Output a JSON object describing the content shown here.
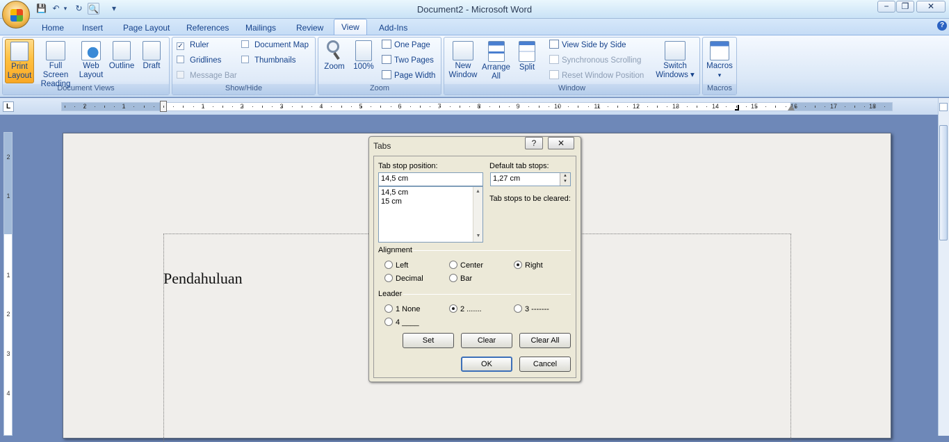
{
  "window": {
    "title": "Document2 - Microsoft Word",
    "minimize": "−",
    "restore": "❐",
    "close": "✕"
  },
  "qat": {
    "save": "💾",
    "undo": "↶",
    "undo_dd": "▾",
    "redo": "↻",
    "print_preview": "🔍",
    "customize": "▾"
  },
  "tabs": [
    "Home",
    "Insert",
    "Page Layout",
    "References",
    "Mailings",
    "Review",
    "View",
    "Add-Ins"
  ],
  "active_tab": "View",
  "help": "?",
  "ribbon": {
    "document_views": {
      "label": "Document Views",
      "buttons": [
        "Print Layout",
        "Full Screen Reading",
        "Web Layout",
        "Outline",
        "Draft"
      ],
      "print_l1": "Print",
      "print_l2": "Layout",
      "full_l1": "Full Screen",
      "full_l2": "Reading",
      "web_l1": "Web",
      "web_l2": "Layout",
      "outline": "Outline",
      "draft": "Draft"
    },
    "show_hide": {
      "label": "Show/Hide",
      "ruler": "Ruler",
      "gridlines": "Gridlines",
      "message_bar": "Message Bar",
      "document_map": "Document Map",
      "thumbnails": "Thumbnails",
      "ruler_checked": true
    },
    "zoom": {
      "label": "Zoom",
      "zoom": "Zoom",
      "percent": "100%",
      "one_page": "One Page",
      "two_pages": "Two Pages",
      "page_width": "Page Width"
    },
    "window": {
      "label": "Window",
      "new_l1": "New",
      "new_l2": "Window",
      "arrange_l1": "Arrange",
      "arrange_l2": "All",
      "split": "Split",
      "side_by_side": "View Side by Side",
      "sync_scroll": "Synchronous Scrolling",
      "reset_pos": "Reset Window Position",
      "switch_l1": "Switch",
      "switch_l2": "Windows ▾"
    },
    "macros": {
      "label": "Macros",
      "macros": "Macros",
      "dd": "▾"
    }
  },
  "ruler": {
    "corner": "L",
    "left_numbers": [
      "2",
      "1"
    ],
    "right_numbers": [
      "1",
      "2",
      "3",
      "4",
      "5",
      "6",
      "7",
      "8",
      "9",
      "10",
      "11",
      "12",
      "13",
      "14",
      "15",
      "16",
      "17",
      "18"
    ],
    "vertical_numbers": [
      "2",
      "1",
      "1",
      "2",
      "3",
      "4"
    ]
  },
  "document": {
    "text": "Pendahuluan"
  },
  "dialog": {
    "title": "Tabs",
    "help": "?",
    "close": "✕",
    "tab_stop_label": "Tab stop position:",
    "tab_stop_value": "14,5 cm",
    "tab_list": [
      "14,5 cm",
      "15 cm"
    ],
    "default_label": "Default tab stops:",
    "default_value": "1,27 cm",
    "cleared_label": "Tab stops to be cleared:",
    "alignment_label": "Alignment",
    "align": {
      "left": "Left",
      "center": "Center",
      "right": "Right",
      "decimal": "Decimal",
      "bar": "Bar"
    },
    "align_selected": "Right",
    "leader_label": "Leader",
    "leader": {
      "l1": "1 None",
      "l2": "2 .......",
      "l3": "3 -------",
      "l4": "4 ____"
    },
    "leader_selected": "2",
    "set": "Set",
    "clear": "Clear",
    "clear_all": "Clear All",
    "ok": "OK",
    "cancel": "Cancel"
  }
}
